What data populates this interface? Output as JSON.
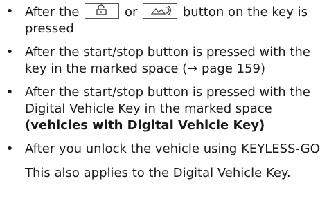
{
  "items": [
    {
      "bullet": "•",
      "pre": "After the",
      "between": "or",
      "post": "button on the key is pressed",
      "icons": [
        "unlock-trunk-icon",
        "remote-start-icon"
      ]
    },
    {
      "bullet": "•",
      "text": "After the start/stop button is pressed with the key in the marked space (→ page 159)"
    },
    {
      "bullet": "•",
      "text": "After the start/stop button is pressed with the Digital Vehicle Key in the marked space ",
      "bold": "(vehicles with Digital Vehicle Key)"
    },
    {
      "bullet": "•",
      "text": "After you unlock the vehicle using KEYLESS-GO"
    }
  ],
  "note": "This also applies to the Digital Vehicle Key."
}
